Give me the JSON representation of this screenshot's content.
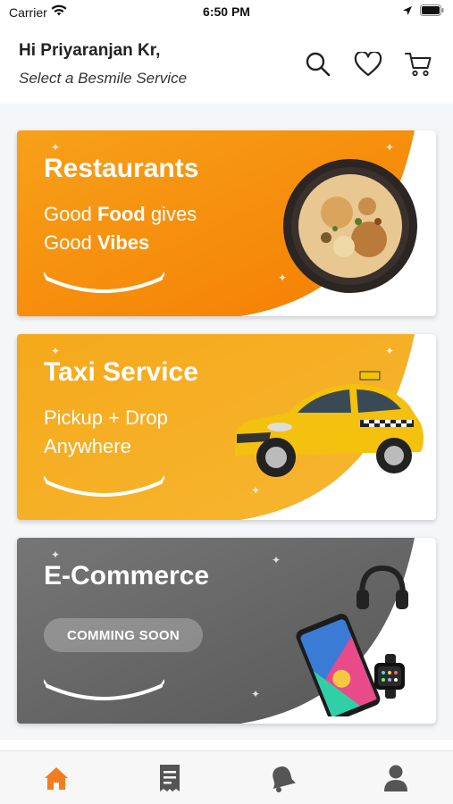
{
  "status_bar": {
    "carrier": "Carrier",
    "time": "6:50 PM"
  },
  "header": {
    "greeting": "Hi Priyaranjan Kr,",
    "subtitle": "Select a Besmile Service",
    "icons": [
      "search-icon",
      "heart-icon",
      "cart-icon"
    ]
  },
  "services": [
    {
      "title": "Restaurants",
      "tagline_line1_pre": "Good ",
      "tagline_line1_bold": "Food",
      "tagline_line1_post": " gives",
      "tagline_line2_pre": "Good ",
      "tagline_line2_bold": "Vibes",
      "gradient": [
        "#f7a11a",
        "#f57c00"
      ],
      "image": "biryani-plate"
    },
    {
      "title": "Taxi Service",
      "tagline_line1_pre": "Pickup",
      "tagline_line1_bold": "",
      "tagline_line1_post": " + Drop",
      "tagline_line2_pre": "Anywhere",
      "tagline_line2_bold": "",
      "gradient": [
        "#f5a91c",
        "#f7b731"
      ],
      "image": "yellow-taxi-car"
    },
    {
      "title": "E-Commerce",
      "badge": "COMMING SOON",
      "gradient": [
        "#707070",
        "#5a5a5a"
      ],
      "image": "phone-headphones-watch"
    }
  ],
  "tab_bar": {
    "tabs": [
      "home-icon",
      "orders-icon",
      "notifications-icon",
      "profile-icon"
    ],
    "active_index": 0,
    "active_color": "#f57c20",
    "inactive_color": "#555555"
  }
}
